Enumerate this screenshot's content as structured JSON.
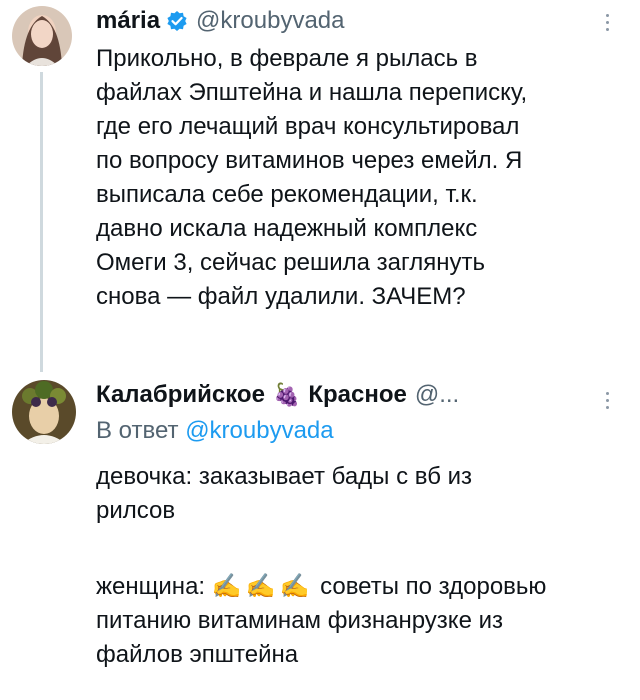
{
  "tweet1": {
    "name": "mária",
    "handle": "@kroubyvada",
    "lines": [
      "Прикольно, в феврале я рылась в",
      "файлах Эпштейна и нашла переписку,",
      "где его лечащий врач консультировал",
      "по вопросу витаминов через емейл. Я",
      "выписала себе рекомендации, т.к.",
      "давно искала надежный комплекс",
      "Омеги 3, сейчас решила заглянуть",
      "снова — файл удалили. ЗАЧЕМ?"
    ]
  },
  "tweet2": {
    "name_part1": "Калабрийское",
    "name_emoji": "🍇",
    "name_part2": "Красное",
    "handle": "@...",
    "reply_prefix": "В ответ",
    "reply_handle": "@kroubyvada",
    "para1": [
      "девочка: заказывает бады с вб из",
      "рилсов"
    ],
    "para2_label": "женщина:",
    "para2_emoji": "✍️✍️✍️",
    "para2_rest": "советы по здоровью",
    "para2_lines": [
      "питанию витаминам физнанрузке из",
      "файлов эпштейна"
    ]
  },
  "icons": {
    "verified": "verified-badge-icon",
    "more": "more-options-icon"
  },
  "colors": {
    "accent": "#1d9bf0",
    "secondary_text": "#536471",
    "thread_line": "#cfd9de"
  }
}
